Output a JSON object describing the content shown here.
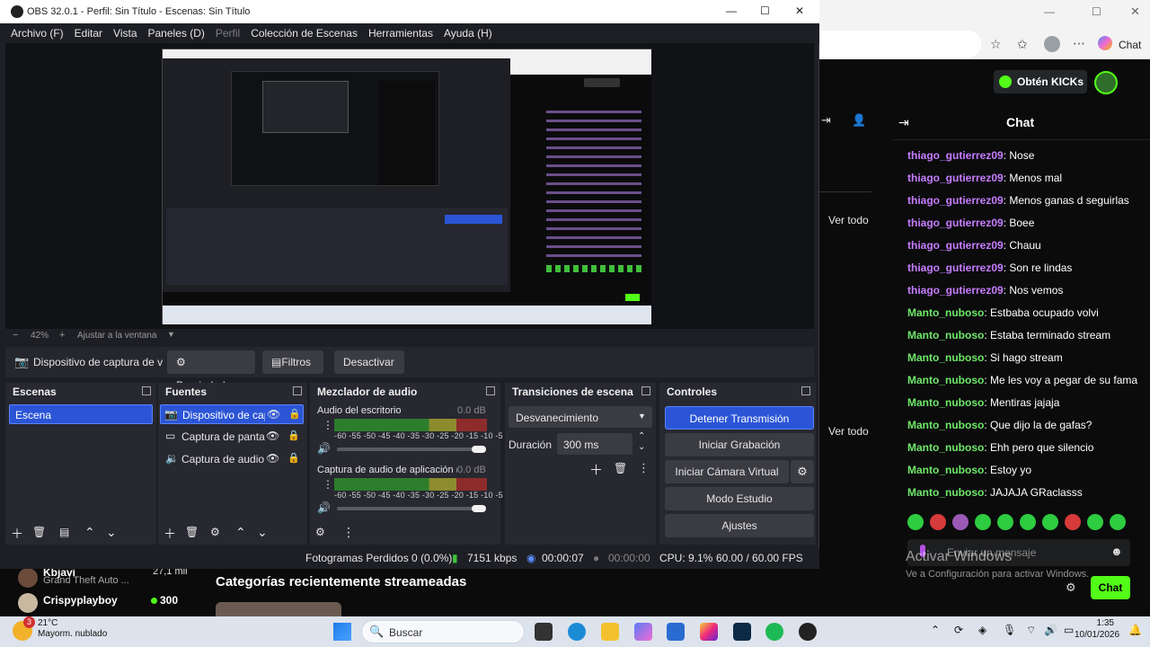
{
  "obs": {
    "title": "OBS 32.0.1 - Perfil: Sin Título - Escenas: Sin Título",
    "window_controls": [
      "—",
      "☐",
      "✕"
    ],
    "menu": [
      "Archivo (F)",
      "Editar",
      "Vista",
      "Paneles (D)",
      "Perfil",
      "Colección de Escenas",
      "Herramientas",
      "Ayuda (H)"
    ],
    "zoom": {
      "minus": "−",
      "value": "42%",
      "plus": "+",
      "fit": "Ajustar a la ventana"
    },
    "source_toolbar": {
      "source_name": "Dispositivo de captura de v",
      "properties": "Propiedades",
      "filters": "Filtros",
      "deactivate": "Desactivar"
    },
    "docks": {
      "scenes": {
        "title": "Escenas",
        "items": [
          "Escena"
        ]
      },
      "sources": {
        "title": "Fuentes",
        "items": [
          "Dispositivo de cap",
          "Captura de panta",
          "Captura de audio"
        ]
      },
      "mixer": {
        "title": "Mezclador de audio",
        "channels": [
          {
            "name": "Audio del escritorio",
            "db": "0.0 dB"
          },
          {
            "name": "Captura de audio de aplicación (BETA)",
            "db": "0.0 dB"
          }
        ],
        "ticks": "-60 -55 -50 -45 -40 -35 -30 -25 -20 -15 -10 -5 0"
      },
      "transitions": {
        "title": "Transiciones de escena",
        "selected": "Desvanecimiento",
        "duration_label": "Duración",
        "duration_value": "300 ms"
      },
      "controls": {
        "title": "Controles",
        "buttons": [
          "Detener Transmisión",
          "Iniciar Grabación",
          "Iniciar Cámara Virtual",
          "Modo Estudio",
          "Ajustes"
        ]
      }
    },
    "status": {
      "dropped": "Fotogramas Perdidos 0 (0.0%)",
      "bitrate": "7151 kbps",
      "stream_time": "00:00:07",
      "rec_time": "00:00:00",
      "cpu": "CPU: 9.1%",
      "fps": "60.00 / 60.00 FPS"
    }
  },
  "browser": {
    "tab_label": "Chat",
    "kicks_button": "Obtén KICKs",
    "chat_title": "Chat",
    "see_all": "Ver todo",
    "messages": [
      {
        "user": "thiago_gutierrez09",
        "text": ": Nose",
        "group": 1
      },
      {
        "user": "thiago_gutierrez09",
        "text": ": Menos mal",
        "group": 1
      },
      {
        "user": "thiago_gutierrez09",
        "text": ": Menos ganas d seguirlas",
        "group": 1
      },
      {
        "user": "thiago_gutierrez09",
        "text": ": Boee",
        "group": 1
      },
      {
        "user": "thiago_gutierrez09",
        "text": ": Chauu",
        "group": 1
      },
      {
        "user": "thiago_gutierrez09",
        "text": ": Son re lindas",
        "group": 1
      },
      {
        "user": "thiago_gutierrez09",
        "text": ": Nos vemos",
        "group": 1
      },
      {
        "user": "Manto_nuboso",
        "text": ": Estbaba ocupado volvi",
        "group": 2
      },
      {
        "user": "Manto_nuboso",
        "text": ": Estaba terminado stream",
        "group": 2
      },
      {
        "user": "Manto_nuboso",
        "text": ": Si hago stream",
        "group": 2
      },
      {
        "user": "Manto_nuboso",
        "text": ": Me les voy a pegar de su fama",
        "group": 2
      },
      {
        "user": "Manto_nuboso",
        "text": ": Mentiras jajaja",
        "group": 2
      },
      {
        "user": "Manto_nuboso",
        "text": ": Que dijo la de gafas?",
        "group": 2
      },
      {
        "user": "Manto_nuboso",
        "text": ": Ehh pero que silencio",
        "group": 2
      },
      {
        "user": "Manto_nuboso",
        "text": ": Estoy yo",
        "group": 2
      },
      {
        "user": "Manto_nuboso",
        "text": ": JAJAJA GRaclasss",
        "group": 2
      }
    ],
    "input_placeholder": "Enviar un mensaje",
    "send_button": "Chat",
    "activate_title": "Activar Windows",
    "activate_sub": "Ve a Configuración para activar Windows."
  },
  "behind": {
    "category_heading": "Categorías recientemente streameadas",
    "row1": {
      "name": "Kbjavi",
      "game": "Grand Theft Auto ...",
      "viewers": "27,1 mil"
    },
    "row2": {
      "name": "Crispyplayboy",
      "viewers": "300"
    }
  },
  "taskbar": {
    "weather_temp": "21°C",
    "weather_desc": "Mayorm. nublado",
    "weather_badge": "3",
    "search": "Buscar",
    "time": "1:35",
    "date": "10/01/2026"
  },
  "colors": {
    "obs_bg": "#1e1f24",
    "dock_bg": "#272830",
    "accent_blue": "#2b55d6",
    "kick_green": "#53fc18",
    "user_purple": "#c77dff",
    "user_green": "#6ee868"
  }
}
